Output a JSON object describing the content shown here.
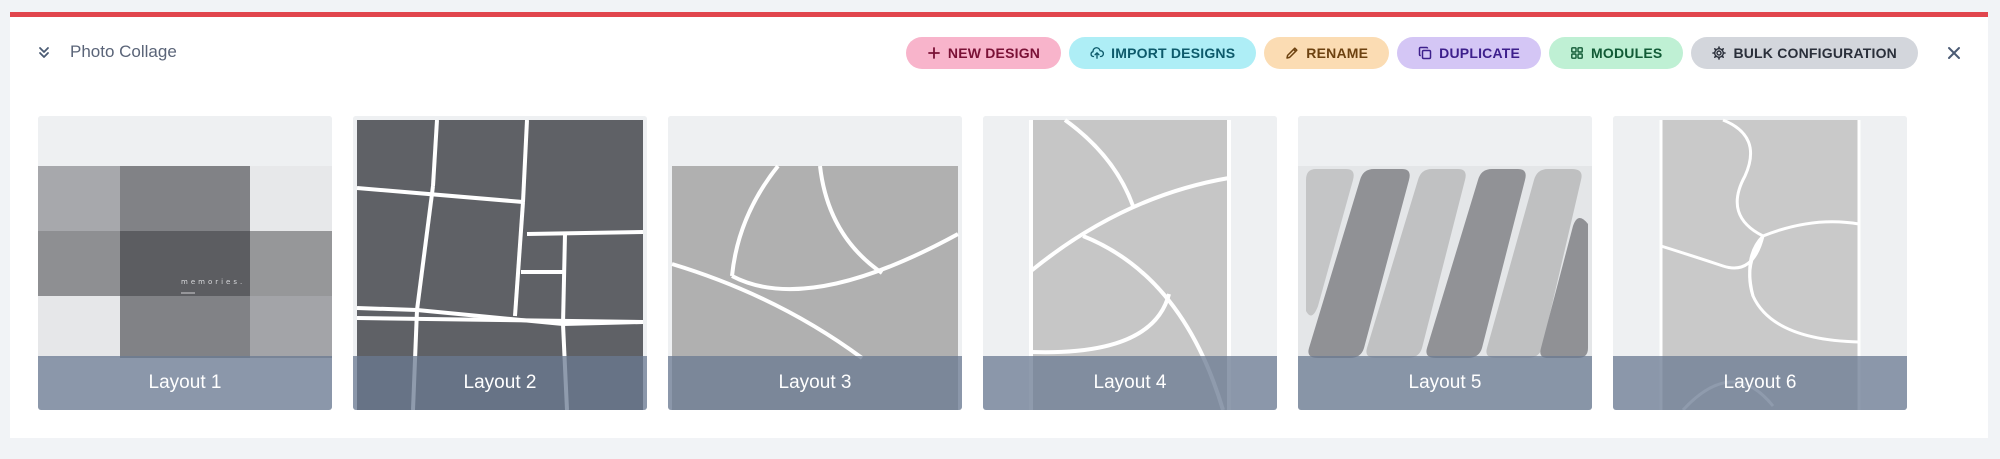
{
  "header": {
    "title": "Photo Collage"
  },
  "toolbar": [
    {
      "label": "NEW DESIGN",
      "icon": "plus-icon",
      "bg": "#f8b4cb",
      "fg": "#7a1136"
    },
    {
      "label": "IMPORT DESIGNS",
      "icon": "cloud-upload-icon",
      "bg": "#aeeef6",
      "fg": "#0d5a6b"
    },
    {
      "label": "RENAME",
      "icon": "pencil-icon",
      "bg": "#fbdcb3",
      "fg": "#6d4210"
    },
    {
      "label": "DUPLICATE",
      "icon": "copy-icon",
      "bg": "#d4c6f5",
      "fg": "#3d1f8c"
    },
    {
      "label": "MODULES",
      "icon": "grid-icon",
      "bg": "#bff0d4",
      "fg": "#115a35"
    },
    {
      "label": "BULK CONFIGURATION",
      "icon": "gear-icon",
      "bg": "#d3d6dc",
      "fg": "#2a2f3a"
    }
  ],
  "layouts": [
    {
      "label": "Layout 1",
      "overlay_text": "memories."
    },
    {
      "label": "Layout 2"
    },
    {
      "label": "Layout 3"
    },
    {
      "label": "Layout 4"
    },
    {
      "label": "Layout 5"
    },
    {
      "label": "Layout 6"
    }
  ],
  "colors": {
    "accent_bar": "#e1454d",
    "caption_overlay": "#6a7992"
  }
}
